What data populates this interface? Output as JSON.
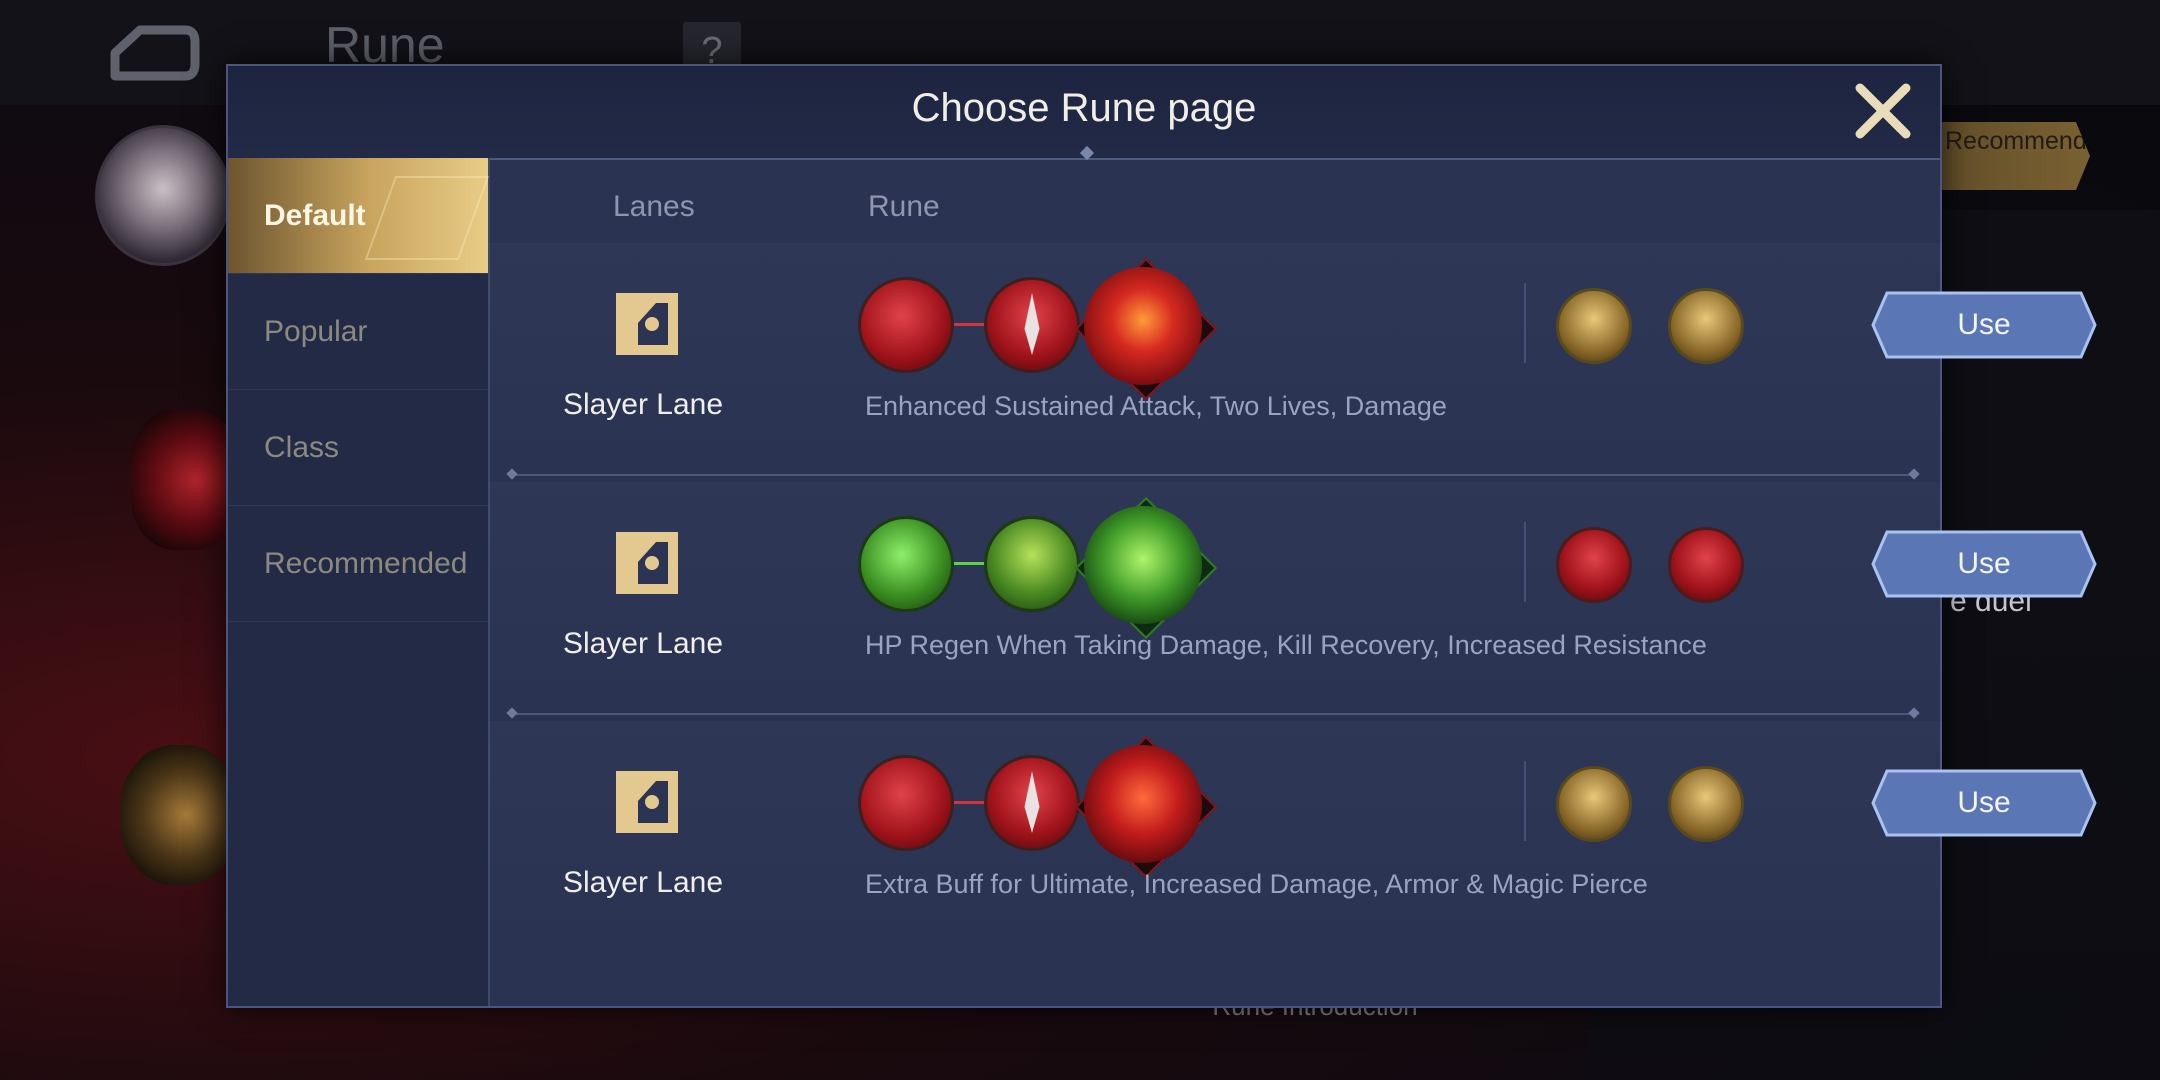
{
  "background": {
    "title": "Rune",
    "help_label": "?",
    "recommended_tag": "Recommended Setting",
    "duel_text": "e duel",
    "rune_intro": "Rune Introduction"
  },
  "modal": {
    "title": "Choose Rune page",
    "close_icon": "close-x-icon",
    "tabs": [
      {
        "label": "Default",
        "active": true
      },
      {
        "label": "Popular",
        "active": false
      },
      {
        "label": "Class",
        "active": false
      },
      {
        "label": "Recommended",
        "active": false
      }
    ],
    "columns": {
      "lanes": "Lanes",
      "rune": "Rune"
    },
    "rows": [
      {
        "lane": "Slayer Lane",
        "description": "Enhanced Sustained Attack, Two Lives, Damage",
        "button": "Use",
        "theme": "red",
        "runes": [
          "sprint-attack-icon",
          "dagger-icon",
          "flaming-sword-icon",
          "lion-icon",
          "arrow-icon"
        ]
      },
      {
        "lane": "Slayer Lane",
        "description": "HP Regen When Taking Damage, Kill Recovery, Increased Resistance",
        "button": "Use",
        "theme": "green",
        "runes": [
          "foot-splash-icon",
          "log-icon",
          "green-armor-icon",
          "blade-icon",
          "demon-icon"
        ]
      },
      {
        "lane": "Slayer Lane",
        "description": "Extra Buff for Ultimate, Increased Damage, Armor & Magic Pierce",
        "button": "Use",
        "theme": "red",
        "runes": [
          "blade-icon",
          "dagger-icon",
          "demon-face-icon",
          "lion-icon",
          "arrow-icon"
        ]
      }
    ]
  },
  "colors": {
    "gold": "#c9a55e",
    "red_rune": "#a8141c",
    "green_rune": "#3f8f24",
    "use_button": "#5f7cc0"
  }
}
